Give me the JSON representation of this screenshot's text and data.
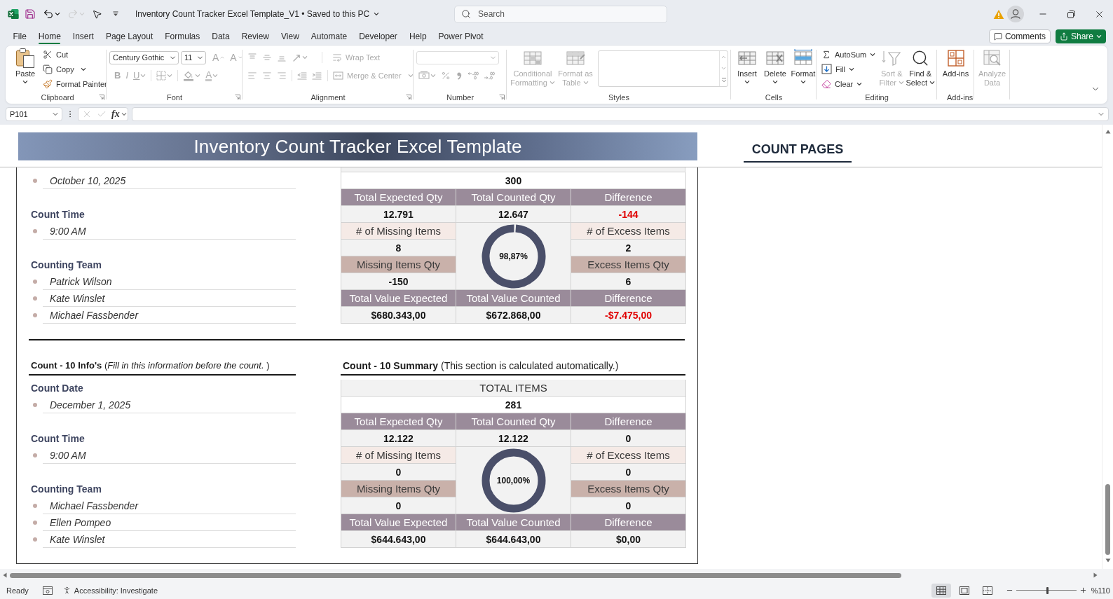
{
  "title_bar": {
    "title": "Inventory Count Tracker Excel Template_V1 • Saved to this PC",
    "search": {
      "placeholder": "Search"
    },
    "quick_access": [
      {
        "disabled": false
      },
      {
        "disabled": false
      },
      {
        "disabled": true
      },
      {
        "disabled": false
      }
    ]
  },
  "menu": {
    "tabs": [
      {
        "label": "File",
        "selected": false
      },
      {
        "label": "Home",
        "selected": true
      },
      {
        "label": "Insert",
        "selected": false
      },
      {
        "label": "Page Layout",
        "selected": false
      },
      {
        "label": "Formulas",
        "selected": false
      },
      {
        "label": "Data",
        "selected": false
      },
      {
        "label": "Review",
        "selected": false
      },
      {
        "label": "View",
        "selected": false
      },
      {
        "label": "Automate",
        "selected": false
      },
      {
        "label": "Developer",
        "selected": false
      },
      {
        "label": "Help",
        "selected": false
      },
      {
        "label": "Power Pivot",
        "selected": false
      }
    ],
    "comments": "Comments",
    "share": "Share"
  },
  "ribbon": {
    "clipboard": {
      "label": "Clipboard",
      "paste": {
        "label": "Paste",
        "disabled": false
      },
      "commands": [
        {
          "label": "Cut",
          "disabled": false
        },
        {
          "label": "Copy",
          "disabled": false
        },
        {
          "label": "Format Painter",
          "disabled": false
        }
      ]
    },
    "font": {
      "label": "Font",
      "font_name": "Century Gothic",
      "font_size": "11",
      "size_buttons": [
        {
          "glyph": "A",
          "disabled": true
        },
        {
          "glyph": "A",
          "disabled": true
        }
      ],
      "format_buttons": [
        {
          "kind": "glyph",
          "glyph": "B",
          "disabled": true
        },
        {
          "kind": "glyph",
          "glyph": "I",
          "disabled": true
        },
        {
          "kind": "glyph",
          "glyph": "U",
          "disabled": true
        },
        {
          "kind": "icon",
          "disabled": true
        },
        {
          "kind": "icon",
          "disabled": true
        },
        {
          "kind": "glyph",
          "glyph": "A",
          "disabled": true
        }
      ]
    },
    "alignment": {
      "label": "Alignment",
      "top_buttons": [
        {
          "disabled": true
        },
        {
          "disabled": true
        },
        {
          "disabled": true
        },
        {
          "disabled": true
        }
      ],
      "bottom_buttons": [
        {
          "disabled": true
        },
        {
          "disabled": true
        },
        {
          "disabled": true
        },
        {
          "disabled": true
        },
        {
          "disabled": true
        }
      ],
      "wrap_text": {
        "label": "Wrap Text",
        "disabled": true
      },
      "merge": {
        "label": "Merge & Center",
        "disabled": true
      }
    },
    "number": {
      "label": "Number",
      "format_select": {
        "disabled": true
      },
      "buttons": [
        {
          "disabled": true
        },
        {
          "disabled": true
        },
        {
          "disabled": true
        },
        {
          "disabled": true
        },
        {
          "disabled": true
        }
      ]
    },
    "styles": {
      "label": "Styles",
      "buttons": [
        {
          "label": "Conditional Formatting",
          "disabled": true
        },
        {
          "label": "Format as Table",
          "disabled": true
        }
      ]
    },
    "cells": {
      "label": "Cells",
      "buttons": [
        {
          "label": "Insert",
          "disabled": false
        },
        {
          "label": "Delete",
          "disabled": false
        },
        {
          "label": "Format",
          "disabled": false
        }
      ]
    },
    "editing": {
      "label": "Editing",
      "commands": [
        {
          "label": "AutoSum",
          "disabled": false
        },
        {
          "label": "Fill",
          "disabled": false
        },
        {
          "label": "Clear",
          "disabled": false
        }
      ],
      "buttons": [
        {
          "label": "Sort & Filter",
          "disabled": true
        },
        {
          "label": "Find & Select",
          "disabled": false
        }
      ]
    },
    "add_ins": {
      "label": "Add-ins",
      "button": {
        "label": "Add-ins",
        "disabled": false
      }
    },
    "analyze_data": {
      "button": {
        "label": "Analyze Data",
        "disabled": true
      }
    }
  },
  "formula_bar": {
    "name_box": "P101",
    "edit_buttons": [
      {
        "disabled": true
      },
      {
        "disabled": true
      }
    ],
    "function_glyph": "fx"
  },
  "sheet": {
    "title": "Inventory Count Tracker Excel Template",
    "link": "COUNT PAGES",
    "sections": [
      {
        "info": {
          "fields": [
            {
              "values": [
                "October 10, 2025"
              ]
            },
            {
              "label": "Count Time",
              "values": [
                "9:00 AM"
              ]
            },
            {
              "label": "Counting Team",
              "values": [
                "Patrick Wilson",
                "Kate Winslet",
                "Michael Fassbender"
              ]
            }
          ]
        },
        "summary": {
          "total_items": {
            "value": "300"
          },
          "quantity": {
            "headers": [
              "Total Expected Qty",
              "Total Counted Qty",
              "Difference"
            ],
            "values": [
              {
                "text": "12.791",
                "alert": false
              },
              {
                "text": "12.647",
                "alert": false
              },
              {
                "text": "-144",
                "alert": true
              }
            ]
          },
          "missing": {
            "count_label": "# of Missing Items",
            "count": "8",
            "qty_label": "Missing Items Qty",
            "qty": "-150"
          },
          "excess": {
            "count_label": "# of Excess Items",
            "count": "2",
            "qty_label": "Excess Items Qty",
            "qty": "6"
          },
          "accuracy": {
            "reading": "98,87%",
            "level": 0.9887
          },
          "value": {
            "headers": [
              "Total Value Expected",
              "Total Value Counted",
              "Difference"
            ],
            "values": [
              {
                "text": "$680.343,00",
                "alert": false
              },
              {
                "text": "$672.868,00",
                "alert": false
              },
              {
                "text": "-$7.475,00",
                "alert": true
              }
            ]
          }
        }
      },
      {
        "info": {
          "heading": "**Count - 10 Info's** (*Fill in this information before the count.* )",
          "fields": [
            {
              "label": "Count Date",
              "values": [
                "December 1, 2025"
              ]
            },
            {
              "label": "Count Time",
              "values": [
                "9:00 AM"
              ]
            },
            {
              "label": "Counting Team",
              "values": [
                "Michael Fassbender",
                "Ellen Pompeo",
                "Kate Winslet"
              ]
            }
          ]
        },
        "summary": {
          "heading": "**Count - 10 Summary** (This section is calculated automatically.)",
          "total_items": {
            "label": "TOTAL ITEMS",
            "value": "281"
          },
          "quantity": {
            "headers": [
              "Total Expected Qty",
              "Total Counted Qty",
              "Difference"
            ],
            "values": [
              {
                "text": "12.122",
                "alert": false
              },
              {
                "text": "12.122",
                "alert": false
              },
              {
                "text": "0",
                "alert": false
              }
            ]
          },
          "missing": {
            "count_label": "# of Missing Items",
            "count": "0",
            "qty_label": "Missing Items Qty",
            "qty": "0"
          },
          "excess": {
            "count_label": "# of Excess Items",
            "count": "0",
            "qty_label": "Excess Items Qty",
            "qty": "0"
          },
          "accuracy": {
            "reading": "100,00%",
            "level": 1
          },
          "value": {
            "headers": [
              "Total Value Expected",
              "Total Value Counted",
              "Difference"
            ],
            "values": [
              {
                "text": "$644.643,00",
                "alert": false
              },
              {
                "text": "$644.643,00",
                "alert": false
              },
              {
                "text": "$0,00",
                "alert": false
              }
            ]
          }
        }
      }
    ]
  },
  "status_bar": {
    "mode": "Ready",
    "accessibility": "Accessibility: Investigate",
    "views": [
      {
        "selected": true
      },
      {
        "selected": false
      },
      {
        "selected": false
      }
    ],
    "zoom": {
      "level": 0.52,
      "reading": "%110"
    }
  }
}
